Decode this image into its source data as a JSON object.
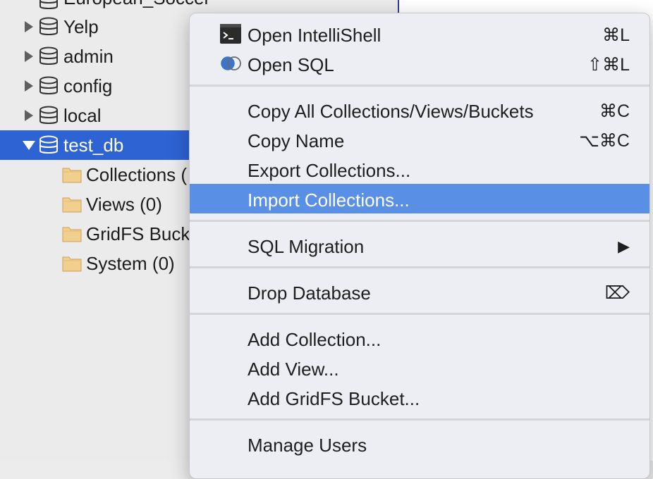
{
  "tree": {
    "partial_top_label": "European_Soccer",
    "databases": [
      {
        "label": "Yelp"
      },
      {
        "label": "admin"
      },
      {
        "label": "config"
      },
      {
        "label": "local"
      },
      {
        "label": "test_db",
        "selected": true
      }
    ],
    "children": [
      {
        "label": "Collections ("
      },
      {
        "label": "Views (0)"
      },
      {
        "label": "GridFS Buck"
      },
      {
        "label": "System (0)"
      }
    ]
  },
  "menu": {
    "items": [
      {
        "label": "Open IntelliShell",
        "shortcut": "⌘L",
        "icon": "terminal-icon"
      },
      {
        "label": "Open SQL",
        "shortcut": "⇧⌘L",
        "icon": "sql-icon"
      },
      {
        "label": "Copy All Collections/Views/Buckets",
        "shortcut": "⌘C"
      },
      {
        "label": "Copy Name",
        "shortcut": "⌥⌘C"
      },
      {
        "label": "Export Collections..."
      },
      {
        "label": "Import Collections...",
        "highlighted": true
      },
      {
        "label": "SQL Migration",
        "submenu": "▶"
      },
      {
        "label": "Drop Database",
        "shortcut": "⌦"
      },
      {
        "label": "Add Collection..."
      },
      {
        "label": "Add View..."
      },
      {
        "label": "Add GridFS Bucket..."
      },
      {
        "label": "Manage Users"
      }
    ]
  },
  "colors": {
    "selection": "#2e63d4",
    "menu_highlight": "#5a8fe6",
    "folder": "#f1cf8e"
  }
}
